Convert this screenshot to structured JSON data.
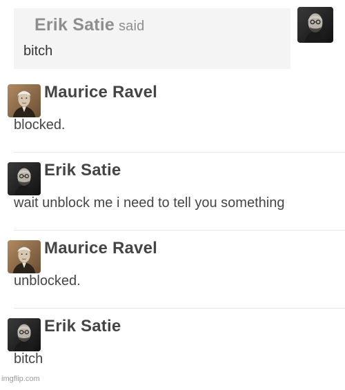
{
  "quote": {
    "author": "Erik Satie",
    "said_label": "said",
    "text": "bitch",
    "avatar_icon": "erik-satie-portrait"
  },
  "messages": [
    {
      "author": "Maurice Ravel",
      "text": "blocked.",
      "avatar_icon": "maurice-ravel-portrait"
    },
    {
      "author": "Erik Satie",
      "text": "wait unblock me i need to tell you something",
      "avatar_icon": "erik-satie-portrait"
    },
    {
      "author": "Maurice Ravel",
      "text": "unblocked.",
      "avatar_icon": "maurice-ravel-portrait"
    },
    {
      "author": "Erik Satie",
      "text": "bitch",
      "avatar_icon": "erik-satie-portrait"
    }
  ],
  "watermark": "imgflip.com",
  "colors": {
    "quote_background": "#f4f4f4",
    "muted_text": "#8e8e8e",
    "text": "#444444",
    "divider": "#e6e6e6"
  }
}
